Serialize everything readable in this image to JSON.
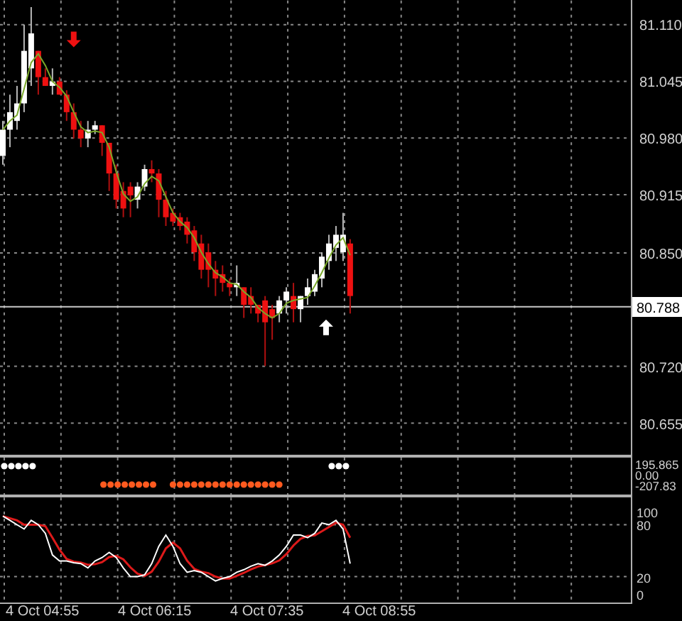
{
  "price_axis": {
    "labels": [
      "81.110",
      "81.045",
      "80.980",
      "80.915",
      "80.850",
      "80.720",
      "80.655"
    ],
    "current_price": "80.788"
  },
  "signal_panel": {
    "axis_labels": [
      "195.865",
      "0.00",
      "-207.83"
    ]
  },
  "stochastic_panel": {
    "axis_labels": [
      "100",
      "80",
      "20",
      "0"
    ]
  },
  "time_axis": {
    "labels": [
      "4 Oct 04:55",
      "4 Oct 06:15",
      "4 Oct 07:35",
      "4 Oct 08:55"
    ]
  }
}
